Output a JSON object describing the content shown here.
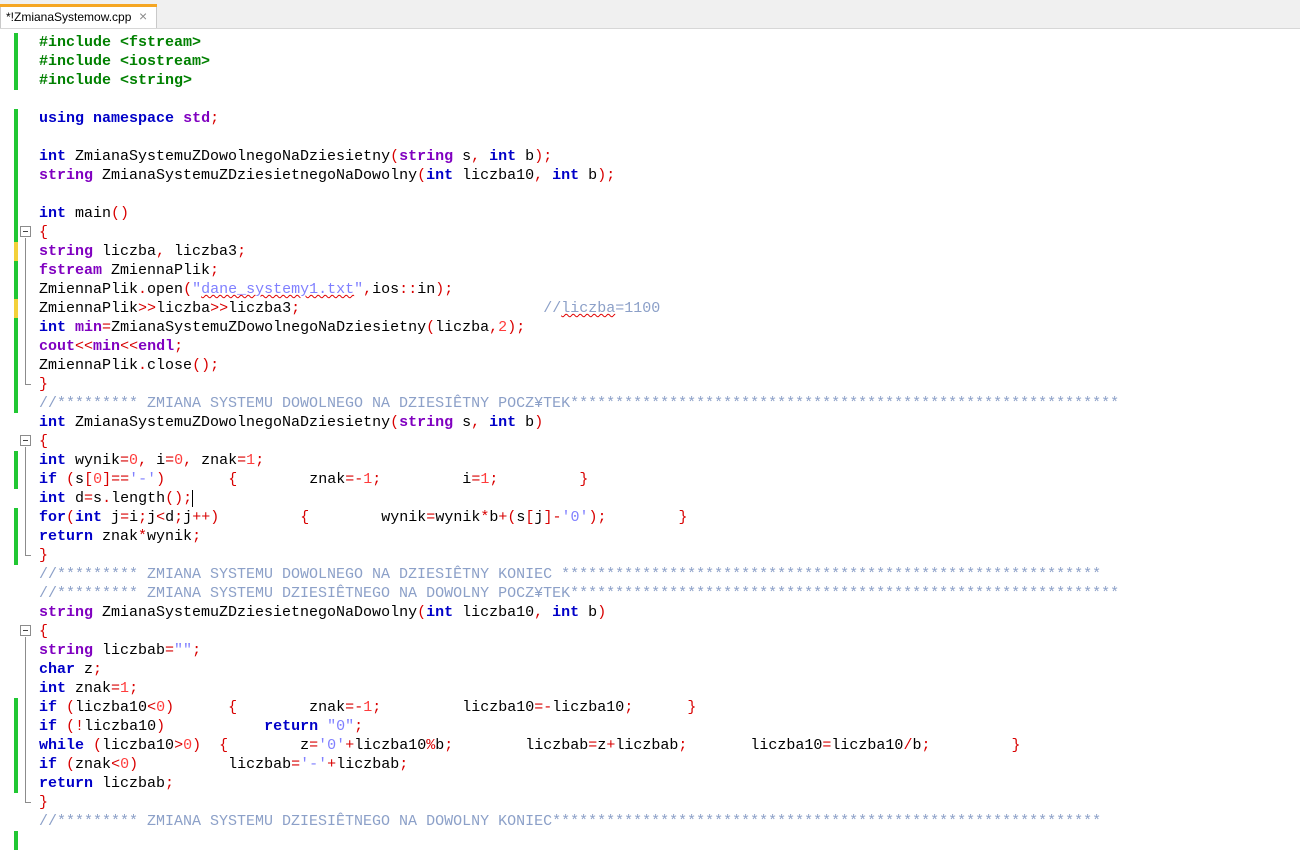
{
  "tab": {
    "title": "*!ZmianaSystemow.cpp",
    "close_label": "×"
  },
  "editor": {
    "lines": [
      "#include <fstream>",
      "#include <iostream>",
      "#include <string>",
      "",
      "using namespace std;",
      "",
      "int ZmianaSystemuZDowolnegoNaDziesietny(string s, int b);",
      "string ZmianaSystemuZDziesietnegoNaDowolny(int liczba10, int b);",
      "",
      "int main()",
      "{",
      "string liczba, liczba3;",
      "fstream ZmiennaPlik;",
      "ZmiennaPlik.open(\"dane_systemy1.txt\",ios::in);",
      "ZmiennaPlik>>liczba>>liczba3;                           //liczba=1100",
      "int min=ZmianaSystemuZDowolnegoNaDziesietny(liczba,2);",
      "cout<<min<<endl;",
      "ZmiennaPlik.close();",
      "}",
      "//********* ZMIANA SYSTEMU DOWOLNEGO NA DZIESIÊTNY POCZ¥TEK*************************************************************",
      "int ZmianaSystemuZDowolnegoNaDziesietny(string s, int b)",
      "{",
      "int wynik=0, i=0, znak=1;",
      "if (s[0]=='-')       {        znak=-1;         i=1;         }",
      "int d=s.length();",
      "for(int j=i;j<d;j++)         {        wynik=wynik*b+(s[j]-'0');        }",
      "return znak*wynik;",
      "}",
      "//********* ZMIANA SYSTEMU DOWOLNEGO NA DZIESIÊTNY KONIEC ************************************************************",
      "//********* ZMIANA SYSTEMU DZIESIÊTNEGO NA DOWOLNY POCZ¥TEK*************************************************************",
      "string ZmianaSystemuZDziesietnegoNaDowolny(int liczba10, int b)",
      "{",
      "string liczbab=\"\";",
      "char z;",
      "int znak=1;",
      "if (liczba10<0)      {        znak=-1;         liczba10=-liczba10;      }",
      "if (!liczba10)           return \"0\";",
      "while (liczba10>0)  {        z='0'+liczba10%b;        liczbab=z+liczbab;       liczba10=liczba10/b;         }",
      "if (znak<0)          liczbab='-'+liczbab;",
      "return liczbab;",
      "}",
      "//********* ZMIANA SYSTEMU DZIESIÊTNEGO NA DOWOLNY KONIEC*************************************************************",
      ""
    ]
  },
  "colors": {
    "keyword": "#0000c8",
    "type": "#8000c0",
    "operator": "#d80000",
    "number": "#ff3c3c",
    "string": "#8080ff",
    "comment": "#8ca0c8",
    "change_saved": "#21c733",
    "change_modified": "#f3d13a",
    "tab_accent": "#f5a623"
  }
}
